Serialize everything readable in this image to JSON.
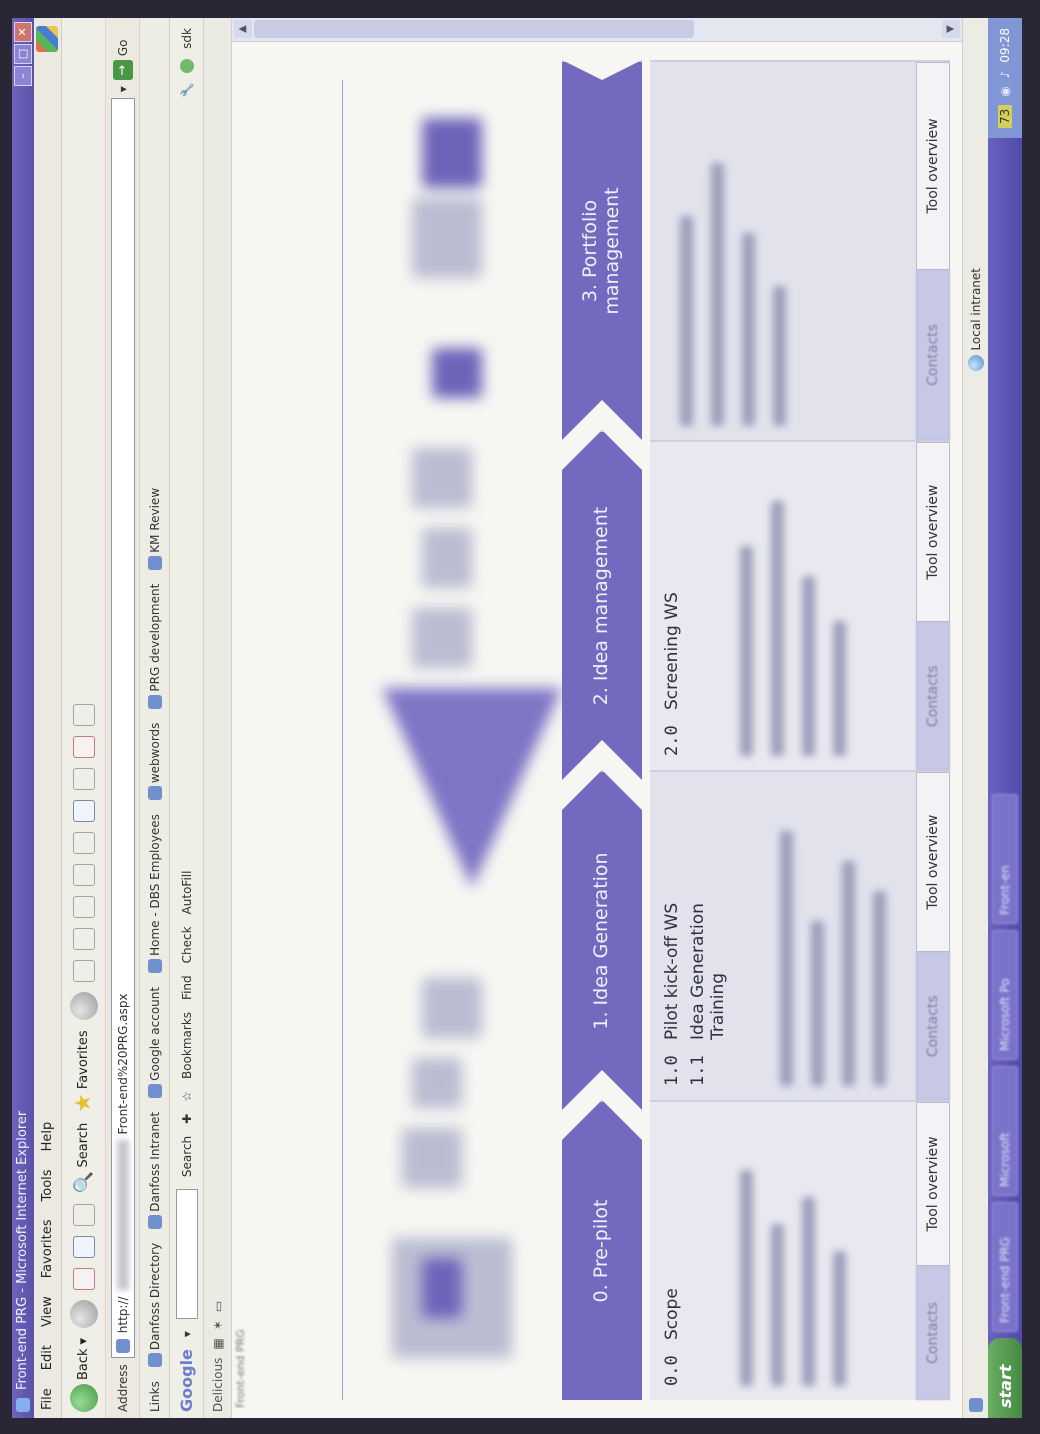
{
  "window": {
    "title": "Front-end PRG - Microsoft Internet Explorer"
  },
  "menu": [
    "File",
    "Edit",
    "View",
    "Favorites",
    "Tools",
    "Help"
  ],
  "toolbar": {
    "back_label": "Back",
    "search_label": "Search",
    "favorites_label": "Favorites"
  },
  "address": {
    "label": "Address",
    "url_prefix": "http://",
    "url_suffix": "Front-end%20PRG.aspx",
    "go_label": "Go"
  },
  "links": {
    "label": "Links",
    "items": [
      "Danfoss Directory",
      "Danfoss Intranet",
      "Google account",
      "Home - DBS Employees",
      "webwords",
      "PRG development",
      "KM Review"
    ]
  },
  "google_bar": {
    "logo": "Google",
    "search_label": "Search",
    "bookmarks_label": "Bookmarks",
    "find_label": "Find",
    "check_label": "Check",
    "autofill_label": "AutoFill",
    "user": "sdk"
  },
  "delicious": {
    "label": "Delicious"
  },
  "page": {
    "breadcrumb": "Front-end PRG"
  },
  "phases": [
    "0. Pre-pilot",
    "1. Idea Generation",
    "2. Idea management",
    "3. Portfolio management"
  ],
  "columns": [
    {
      "items": [
        {
          "num": "0.0",
          "label": "Scope"
        }
      ],
      "contacts_label": "Contacts",
      "tool_label": "Tool overview"
    },
    {
      "items": [
        {
          "num": "1.0",
          "label": "Pilot kick-off WS"
        },
        {
          "num": "1.1",
          "label": "Idea Generation Training"
        }
      ],
      "contacts_label": "Contacts",
      "tool_label": "Tool overview"
    },
    {
      "items": [
        {
          "num": "2.0",
          "label": "Screening WS"
        }
      ],
      "contacts_label": "Contacts",
      "tool_label": "Tool overview"
    },
    {
      "items": [],
      "contacts_label": "Contacts",
      "tool_label": "Tool overview"
    }
  ],
  "statusbar": {
    "zone": "Local intranet"
  },
  "taskbar": {
    "start_label": "start",
    "tasks": [
      "Front-end PRG",
      "Microsoft",
      "Microsoft Po",
      "Front-en"
    ],
    "tray_badge": "73",
    "clock": "09:28"
  }
}
